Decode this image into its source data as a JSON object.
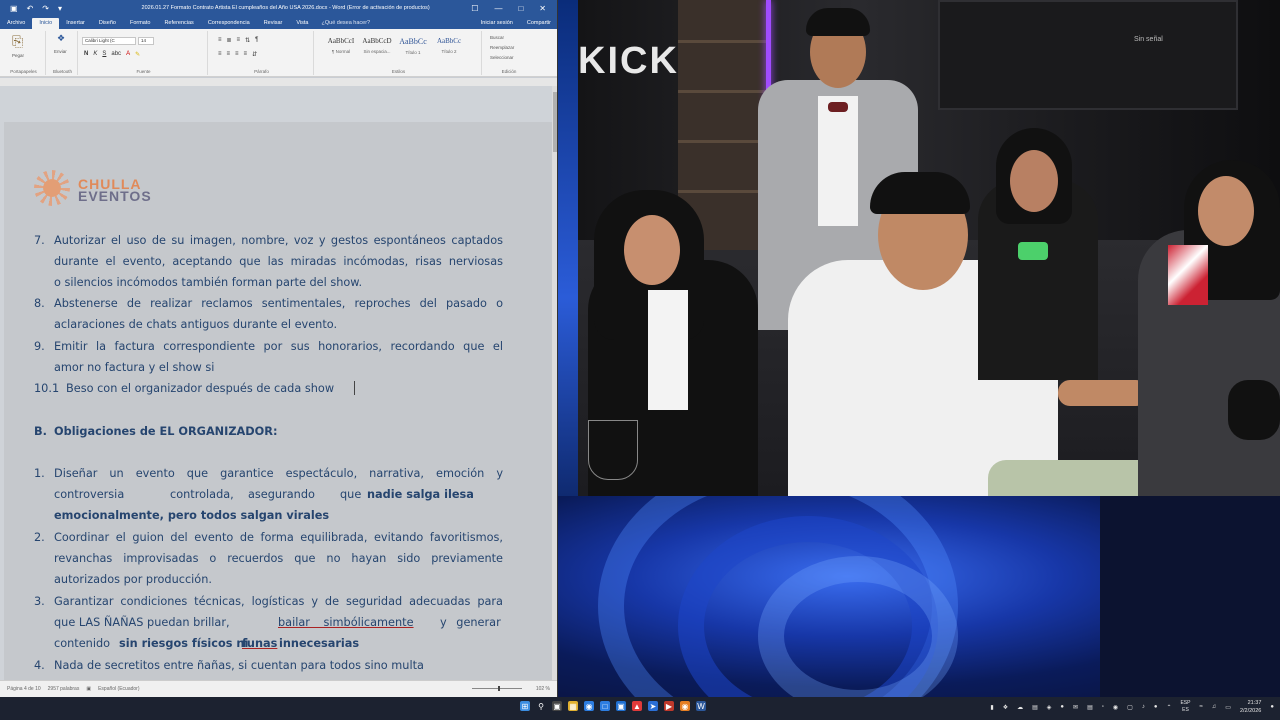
{
  "word": {
    "qat": [
      "▣",
      "↶",
      "↷",
      "▾"
    ],
    "title": "2026.01.27 Formato Contrato Artista El cumpleaños del Año USA 2026.docx - Word (Error de activación de productos)",
    "window_controls": [
      "☐",
      "—",
      "□",
      "✕"
    ],
    "tabs": [
      "Archivo",
      "Inicio",
      "Insertar",
      "Diseño",
      "Formato",
      "Referencias",
      "Correspondencia",
      "Revisar",
      "Vista"
    ],
    "active_tab": "Inicio",
    "tell_me": "¿Qué desea hacer?",
    "sign_in": "Iniciar sesión",
    "share": "Compartir",
    "ribbon": {
      "clipboard": {
        "paste": "Pegar",
        "label": "Portapapeles"
      },
      "bluetooth": {
        "send": "Enviar",
        "label": "Bluetooth"
      },
      "font": {
        "name": "Calibri Light (C",
        "size": "14",
        "label": "Fuente"
      },
      "paragraph": {
        "label": "Párrafo"
      },
      "styles": {
        "items": [
          {
            "sample": "AaBbCcI",
            "name": "¶ Normal"
          },
          {
            "sample": "AaBbCcD",
            "name": "Sin espacia..."
          },
          {
            "sample": "AaBbCc",
            "name": "Título 1"
          },
          {
            "sample": "AaBbCc",
            "name": "Título 2"
          }
        ],
        "label": "Estilos"
      },
      "editing": {
        "find": "Buscar",
        "replace": "Reemplazar",
        "select": "Seleccionar",
        "label": "Edición"
      }
    },
    "logo": {
      "line1": "CHULLA",
      "line2": "EVENTOS"
    },
    "items": [
      {
        "num": "7.",
        "lines": [
          "Autorizar el uso de su imagen, nombre, voz y gestos espontáneos captados",
          "durante el evento, aceptando que las miradas incómodas, risas nerviosas",
          "o silencios incómodos también forman parte del show."
        ]
      },
      {
        "num": "8.",
        "lines": [
          "Abstenerse de realizar reclamos sentimentales, reproches del pasado o",
          "aclaraciones de chats antiguos durante el evento."
        ]
      },
      {
        "num": "9.",
        "lines": [
          "Emitir la factura correspondiente por sus honorarios, recordando que el",
          "amor no factura y el show si"
        ]
      },
      {
        "num": "10.1",
        "lines": [
          "Beso con el organizador después de cada show"
        ]
      }
    ],
    "section_b": {
      "letter": "B.",
      "title": "Obligaciones de EL ORGANIZADOR:"
    },
    "b_items": [
      {
        "num": "1.",
        "l1": "Diseñar un evento que garantice espectáculo, narrativa, emoción y",
        "l2a": "controversia",
        "l2b": "controlada,",
        "l2c": "asegurando",
        "l2d": "que",
        "l2e": "nadie salga ilesa",
        "l3a": "emocionalmente, pero todos salgan virales",
        "l3b": "."
      },
      {
        "num": "2.",
        "lines": [
          "Coordinar el guion del evento de forma equilibrada, evitando favoritismos,",
          "revanchas improvisadas o recuerdos que no hayan sido previamente",
          "autorizados por producción."
        ]
      },
      {
        "num": "3.",
        "l1": "Garantizar condiciones técnicas, logísticas y de seguridad adecuadas para",
        "l2a": "que LAS ÑAÑAS puedan brillar,",
        "l2b": "bailar simbólicamente",
        "l2c": "y generar",
        "l3a": "contenido",
        "l3b": "sin riesgos físicos ni",
        "l3c": "funas",
        "l3d": "innecesarias",
        "l3e": "."
      },
      {
        "num": "4.",
        "lines": [
          "Nada de secretitos entre ñañas, si cuentan para todos sino multa"
        ]
      }
    ],
    "status": {
      "page": "Página 4 de 10",
      "words": "2957 palabras",
      "lang": "Español (Ecuador)",
      "zoom": "102 %"
    }
  },
  "video": {
    "brand": "KICK",
    "tv_text": "Sin señal"
  },
  "taskbar": {
    "tray": {
      "lang1": "ESP",
      "lang2": "ES",
      "time": "21:37",
      "date": "2/2/2026"
    }
  }
}
